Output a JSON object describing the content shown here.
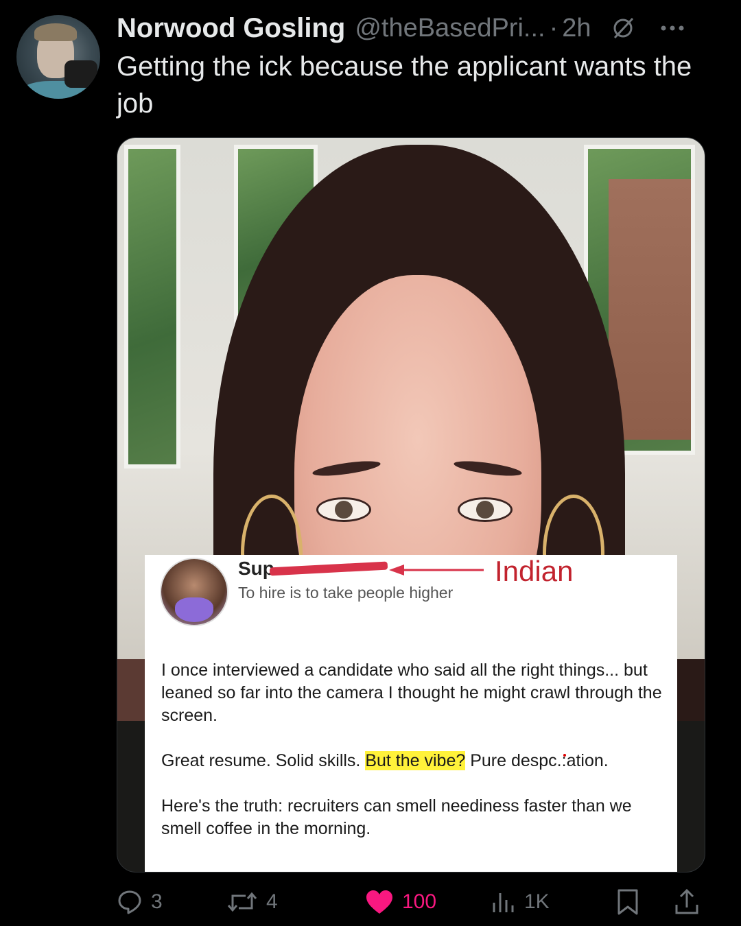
{
  "tweet": {
    "author_name": "Norwood Gosling",
    "handle": "@theBasedPri...",
    "separator": "·",
    "time": "2h",
    "text": "Getting the ick because the applicant wants the job"
  },
  "embedded_post": {
    "name_visible": "Sup",
    "tagline": "To hire is to take people higher",
    "annotation": "Indian",
    "paragraph1": "I once interviewed a candidate who said all the right things... but leaned so far into the camera I thought he might crawl through the screen.",
    "paragraph2_before": "Great resume. Solid skills. ",
    "paragraph2_highlight": "But the vibe?",
    "paragraph2_after": " Pure despc.:ation.",
    "paragraph3": "Here's the truth: recruiters can smell neediness faster than we smell coffee in the morning."
  },
  "actions": {
    "replies": "3",
    "reposts": "4",
    "likes": "100",
    "views": "1K"
  },
  "colors": {
    "background": "#000000",
    "like_active": "#f91880",
    "muted": "#71767b",
    "highlight": "#fff23a",
    "annotation_red": "#c2232e"
  },
  "icons": [
    "grok-icon",
    "more-icon",
    "reply-icon",
    "repost-icon",
    "like-icon",
    "views-icon",
    "bookmark-icon",
    "share-icon"
  ]
}
